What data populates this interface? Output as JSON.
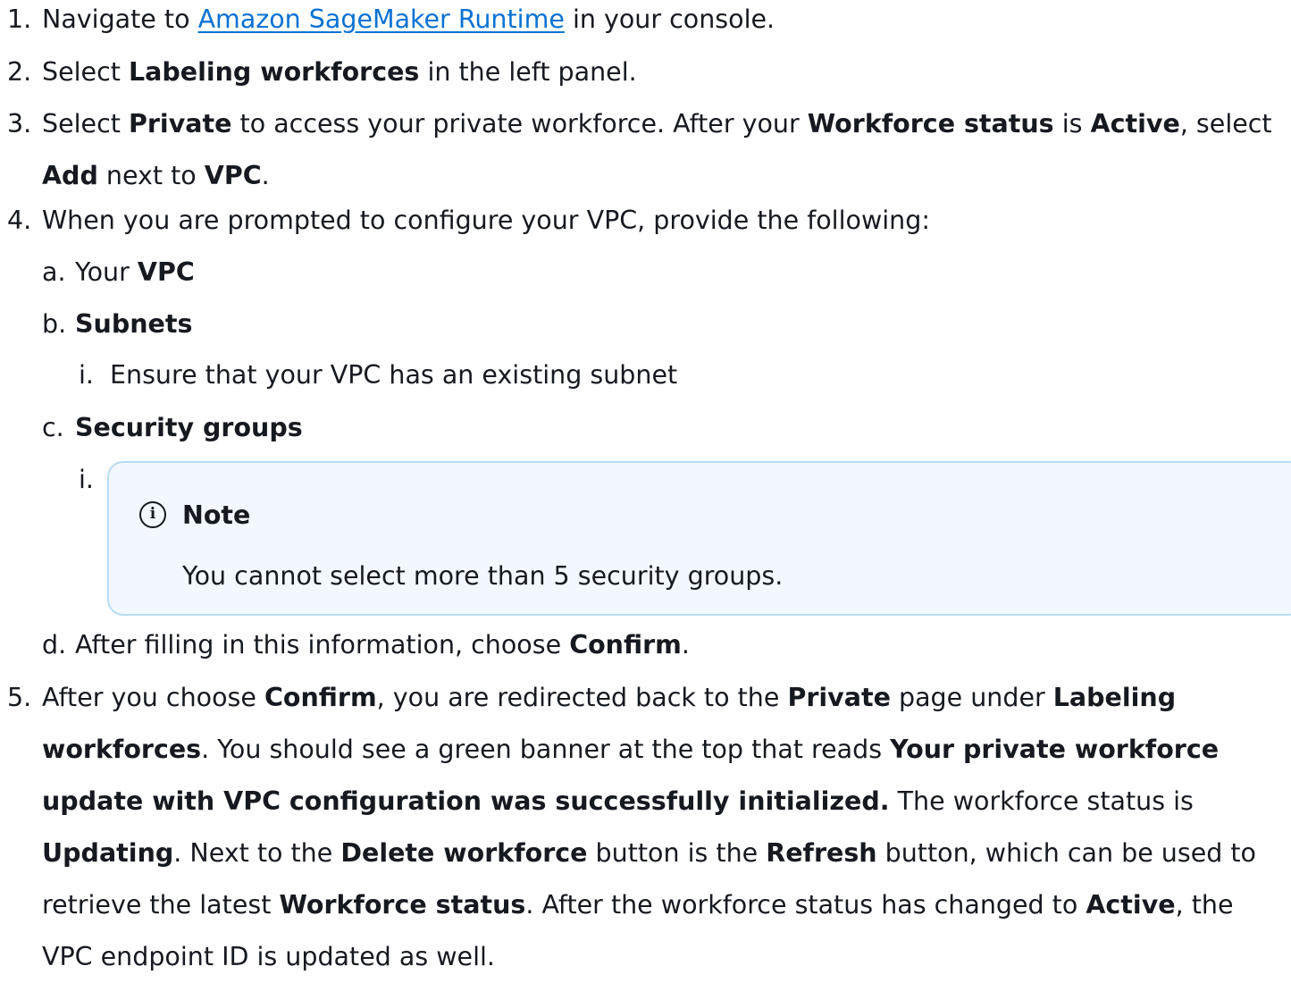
{
  "steps": {
    "s1": {
      "num": "1.",
      "pre": "Navigate to ",
      "link": "Amazon SageMaker Runtime",
      "post": " in your console."
    },
    "s2": {
      "num": "2.",
      "pre": "Select ",
      "b1": "Labeling workforces",
      "post": " in the left panel."
    },
    "s3": {
      "num": "3.",
      "t1": "Select ",
      "b1": "Private",
      "t2": " to access your private workforce. After your ",
      "b2": "Workforce status",
      "t3": " is ",
      "b3": "Active",
      "t4": ", select ",
      "b4": "Add",
      "t5": " next to ",
      "b5": "VPC",
      "t6": "."
    },
    "s4": {
      "num": "4.",
      "text": "When you are prompted to configure your VPC, provide the following:",
      "a": {
        "num": "a.",
        "pre": "Your ",
        "b1": "VPC"
      },
      "b": {
        "num": "b.",
        "b1": "Subnets",
        "i": {
          "num": "i.",
          "text": "Ensure that your VPC has an existing subnet"
        }
      },
      "c": {
        "num": "c.",
        "b1": "Security groups",
        "i": {
          "num": "i."
        }
      },
      "d": {
        "num": "d.",
        "pre": "After filling in this information, choose ",
        "b1": "Confirm",
        "post": "."
      }
    },
    "s5": {
      "num": "5.",
      "t1": "After you choose ",
      "b1": "Confirm",
      "t2": ", you are redirected back to the ",
      "b2": "Private",
      "t3": " page under ",
      "b3": "Labeling workforces",
      "t4": ". You should see a green banner at the top that reads ",
      "b4": "Your private workforce update with VPC configuration was successfully initialized.",
      "t5": " The workforce status is ",
      "b5": "Updating",
      "t6": ". Next to the ",
      "b6": "Delete workforce",
      "t7": " button is the ",
      "b7": "Refresh",
      "t8": " button, which can be used to retrieve the latest ",
      "b8": "Workforce status",
      "t9": ". After the workforce status has changed to ",
      "b9": "Active",
      "t10": ", the VPC endpoint ID is updated as well."
    }
  },
  "note": {
    "icon": "info-icon",
    "title": "Note",
    "body": "You cannot select more than 5 security groups."
  }
}
